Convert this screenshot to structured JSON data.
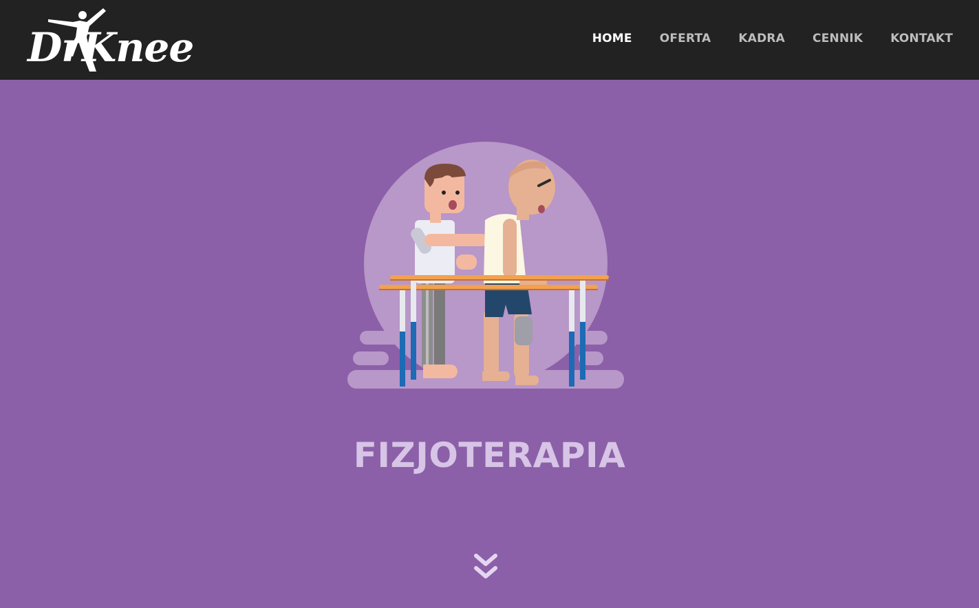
{
  "header": {
    "logo_text": "DrKnee",
    "nav": [
      {
        "label": "HOME",
        "active": true
      },
      {
        "label": "OFERTA",
        "active": false
      },
      {
        "label": "KADRA",
        "active": false
      },
      {
        "label": "CENNIK",
        "active": false
      },
      {
        "label": "KONTAKT",
        "active": false
      }
    ]
  },
  "hero": {
    "title": "FIZJOTERAPIA",
    "illustration": "physiotherapist-assisting-patient-at-parallel-bars",
    "scroll_icon": "double-chevron-down-icon"
  },
  "colors": {
    "header_bg": "#222222",
    "page_bg": "#8b60a8",
    "circle": "#b897c9",
    "title": "#d7c4e6",
    "nav_active": "#ffffff",
    "nav_inactive": "#bdbdbd"
  }
}
